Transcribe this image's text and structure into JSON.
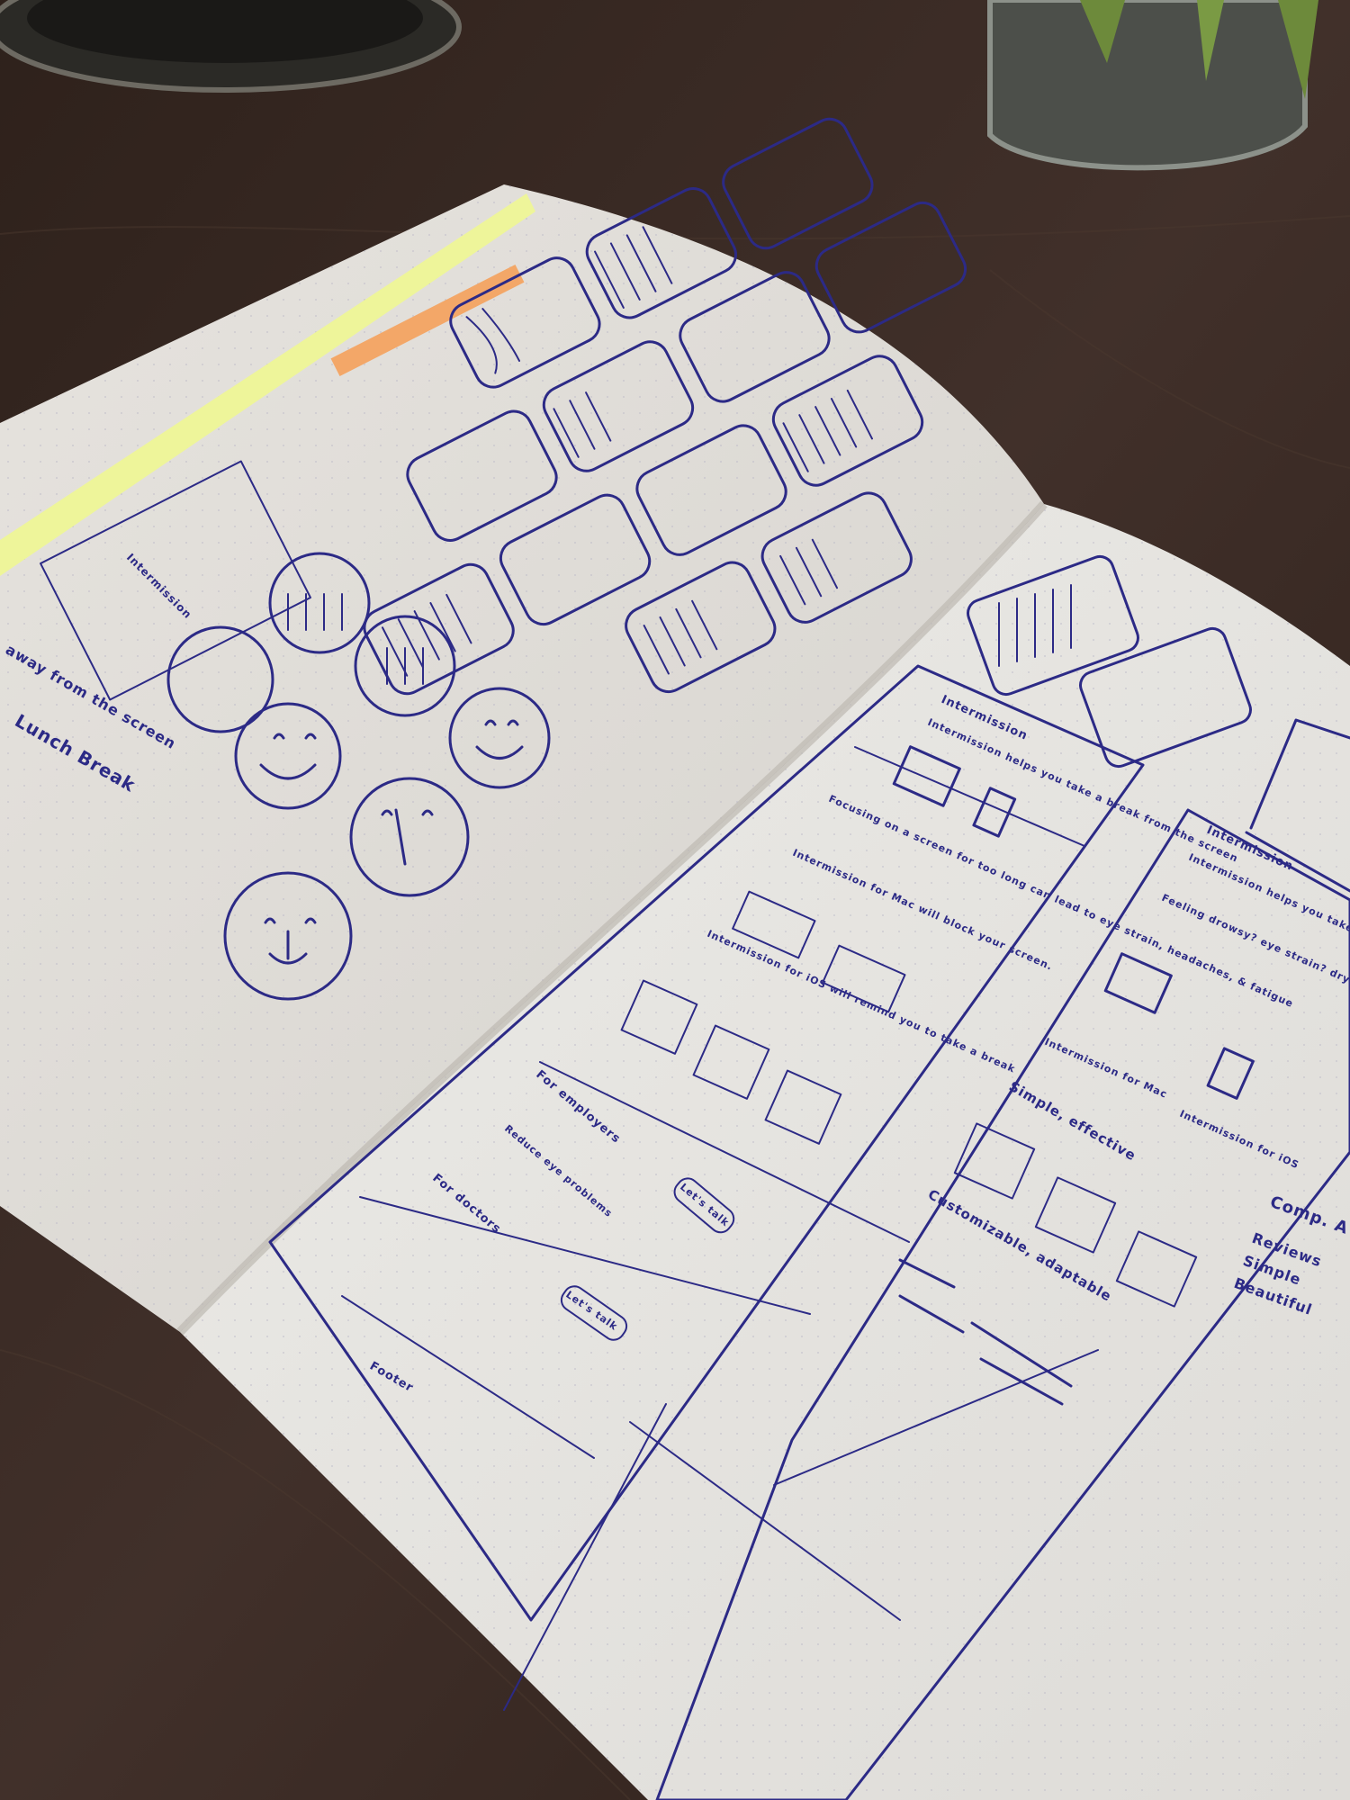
{
  "notebook": {
    "left_page": {
      "notes": [
        "away from the screen",
        "Lunch Break"
      ],
      "card_title": "Intermission"
    },
    "right_page": {
      "wireframe_1": {
        "app_name": "Intermission",
        "headline": "Intermission helps you take a break from the screen",
        "body_1": "Focusing on a screen for too long can lead to eye strain, headaches, & fatigue",
        "body_2": "Intermission for Mac will block your screen.",
        "body_3": "Intermission for iOS will remind you to take a break",
        "section_employers": "For employers",
        "sub_employers": "Reduce eye problems",
        "cta_1": "Let's talk",
        "section_doctors": "For doctors",
        "cta_2": "Let's talk",
        "footer": "Footer"
      },
      "wireframe_2": {
        "app_name": "Intermission",
        "headline": "Intermission helps you take a break. Take the screen.",
        "body_1": "Feeling drowsy? eye strain? dry eyes and posture?",
        "mac_label": "Intermission for Mac",
        "ios_label": "Intermission for iOS",
        "section_1": "Simple, effective",
        "section_2": "Customizable, adaptable"
      },
      "wireframe_3": {
        "list_title": "Comp. A",
        "items": [
          "Reviews",
          "Simple",
          "Beautiful"
        ]
      }
    }
  }
}
